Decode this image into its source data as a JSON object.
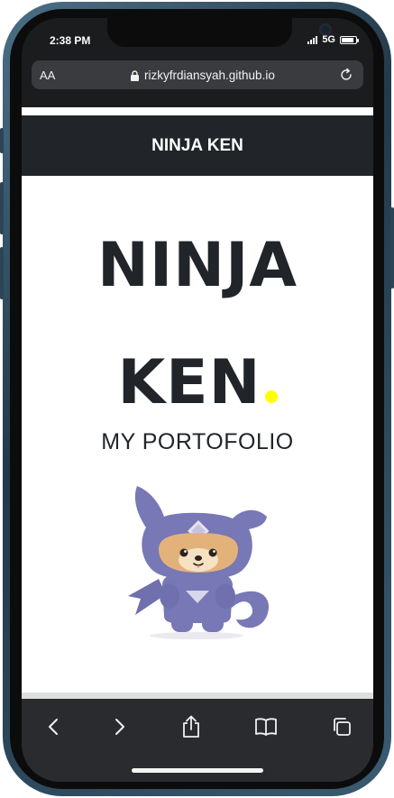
{
  "status_bar": {
    "time": "2:38 PM",
    "network": "5G",
    "battery_level": 0.85
  },
  "browser": {
    "text_size_label": "AA",
    "url": "rizkyfrdiansyah.github.io"
  },
  "page": {
    "nav_title": "NINJA KEN",
    "hero_line_1": "NINJA",
    "hero_line_2": "KEN",
    "subtitle": "MY PORTOFOLIO",
    "accent_color": "#ffff00",
    "nav_color": "#212529"
  },
  "toolbar": {
    "icons": [
      "back-icon",
      "forward-icon",
      "share-icon",
      "bookmarks-icon",
      "tabs-icon"
    ]
  }
}
